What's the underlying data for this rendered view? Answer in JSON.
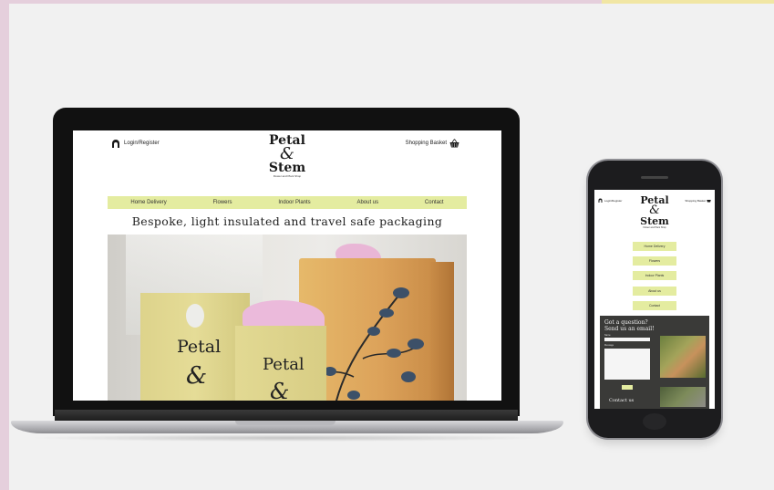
{
  "laptop_site": {
    "login_label": "Login/Register",
    "basket_label": "Shopping Basket",
    "brand": {
      "line1": "Petal",
      "line2": "&",
      "line3": "Stem",
      "tagline": "Flower and Plant Shop"
    },
    "nav": [
      "Home Delivery",
      "Flowers",
      "Indoor Plants",
      "About us",
      "Contact"
    ],
    "headline": "Bespoke, light insulated and travel safe packaging",
    "bag_front_text": "Petal",
    "bag_front_amp": "&",
    "bag_mid_text": "Petal",
    "bag_mid_amp": "&"
  },
  "phone_site": {
    "login_label": "Login/Register",
    "basket_label": "Shopping Basket",
    "brand": {
      "line1": "Petal",
      "line2": "&",
      "line3": "Stem",
      "tagline": "Flower and Plant Shop"
    },
    "nav": [
      "Home Delivery",
      "Flowers",
      "Indoor Plants",
      "About us",
      "Contact"
    ],
    "contact_heading_1": "Got a question?",
    "contact_heading_2": "Send us an email!",
    "name_label": "Name",
    "message_label": "Message",
    "contact_us": "Contact us"
  },
  "colors": {
    "nav_accent": "#e4eca0",
    "device_black": "#111111",
    "background": "#f1f1f1"
  }
}
